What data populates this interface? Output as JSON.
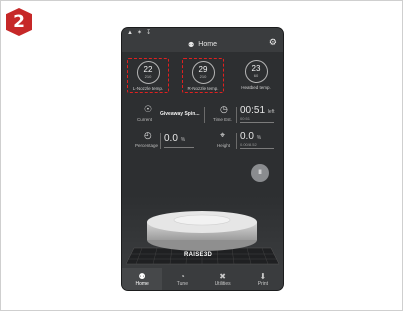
{
  "step_badge": "2",
  "app": {
    "statusbar_icons": "wifi-icon bluetooth-icon usb-icon",
    "header_title": "Home"
  },
  "temps": [
    {
      "current": "22",
      "target": "210",
      "label": "L-Nozzle temp.",
      "highlighted": true
    },
    {
      "current": "29",
      "target": "210",
      "label": "R-Nozzle temp.",
      "highlighted": true
    },
    {
      "current": "23",
      "target": "60",
      "label": "Heatbed temp.",
      "highlighted": false
    }
  ],
  "current_file": {
    "caption": "Current",
    "value": "Giveaway Spin..."
  },
  "time_est": {
    "caption": "Time Est.",
    "value": "00:51",
    "unit": "left",
    "sub": "00:51"
  },
  "percentage": {
    "caption": "Percentage",
    "value": "0.0",
    "unit": "%"
  },
  "height": {
    "caption": "Height",
    "value": "0.0",
    "unit": "%",
    "sub": "0.00/8.52"
  },
  "pause_label": "II",
  "brand_label": "RAISE3D",
  "tabs": [
    {
      "label": "Home",
      "icon": "home-icon",
      "active": true
    },
    {
      "label": "Tune",
      "icon": "tune-icon",
      "active": false
    },
    {
      "label": "Utilities",
      "icon": "utilities-icon",
      "active": false
    },
    {
      "label": "Print",
      "icon": "print-icon",
      "active": false
    }
  ],
  "colors": {
    "highlight": "#e02020",
    "badge": "#c62828",
    "app_bg": "#2d2f31"
  }
}
